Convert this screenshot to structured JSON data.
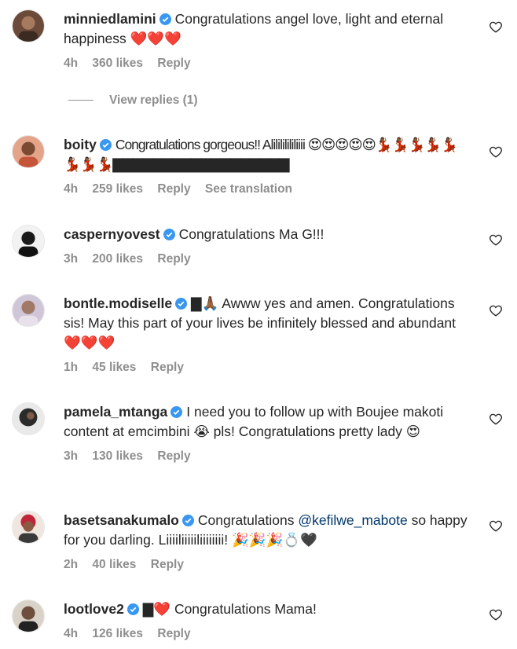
{
  "comments": [
    {
      "username": "minniedlamini",
      "text": "Congratulations angel love, light and eternal happiness ❤️❤️❤️",
      "time": "4h",
      "likes": "360 likes",
      "reply": "Reply"
    },
    {
      "username": "boity",
      "text": "Congratulations gorgeous!! Alilililililiiii 😍😍😍😍😍💃🏾💃🏾💃🏾💃🏾💃🏾💃🏾💃🏾💃🏾▇▇▇▇▇▇▇▇▇▇▇▇▇▇▇▇▇▇",
      "time": "4h",
      "likes": "259 likes",
      "reply": "Reply",
      "translate": "See translation"
    },
    {
      "username": "caspernyovest",
      "text": "Congratulations Ma G!!!",
      "time": "3h",
      "likes": "200 likes",
      "reply": "Reply"
    },
    {
      "username": "bontle.modiselle",
      "text_prefix": "▇🙏🏾 Awww yes and amen.",
      "text": "Congratulations sis! May this part of your lives be infinitely blessed and abundant ❤️❤️❤️",
      "time": "1h",
      "likes": "45 likes",
      "reply": "Reply"
    },
    {
      "username": "pamela_mtanga",
      "text": "I need you to follow up with Boujee makoti content at emcimbini 😭 pls! Congratulations pretty lady 😍",
      "time": "3h",
      "likes": "130 likes",
      "reply": "Reply"
    },
    {
      "username": "basetsanakumalo",
      "text_before": "Congratulations",
      "mention": "@kefilwe_mabote",
      "text_after": "so happy for you darling. Liiiiliiiiiliiiiiiii! 🎉🎉🎉💍🖤",
      "time": "2h",
      "likes": "40 likes",
      "reply": "Reply"
    },
    {
      "username": "lootlove2",
      "text": "▇❤️ Congratulations Mama!",
      "time": "4h",
      "likes": "126 likes",
      "reply": "Reply"
    }
  ],
  "view_replies": "View replies (1)",
  "colors": {
    "text": "#262626",
    "muted": "#8e8e8e",
    "verified": "#3897f0",
    "mention": "#00376b"
  },
  "icons": {
    "like": "heart-outline-icon",
    "verified": "verified-badge-icon"
  }
}
